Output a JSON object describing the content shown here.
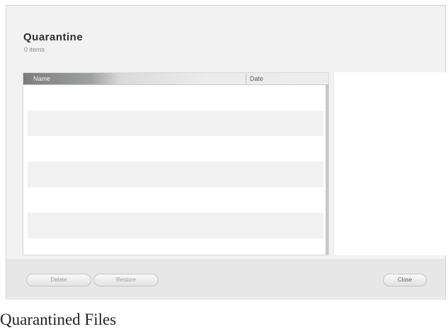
{
  "window": {
    "title": "Quarantine",
    "subtitle": "0 items"
  },
  "list": {
    "columns": [
      "Name",
      "Date"
    ],
    "rows": [
      "",
      "",
      "",
      "",
      "",
      "",
      "",
      ""
    ]
  },
  "footer": {
    "delete_label": "Delete",
    "restore_label": "Restore",
    "close_label": "Close"
  },
  "caption": "Quarantined Files"
}
